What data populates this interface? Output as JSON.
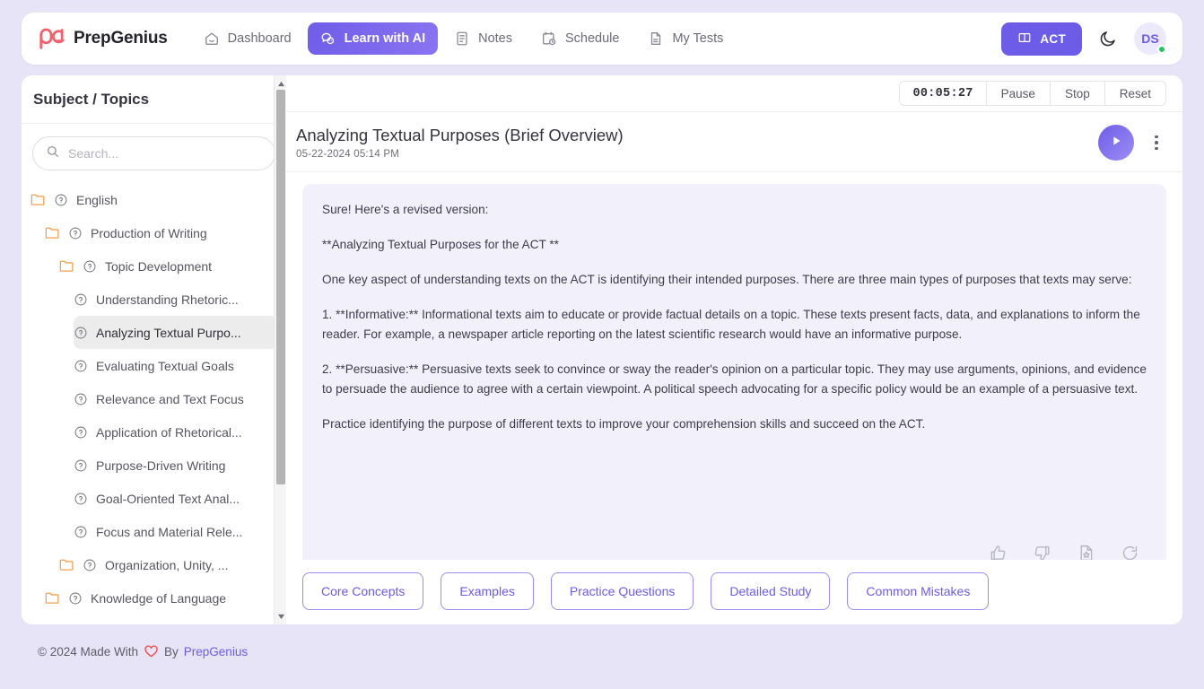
{
  "app": {
    "brand_name": "PrepGenius",
    "logo_icon": "pg-monogram-logo"
  },
  "header": {
    "nav": [
      {
        "label": "Dashboard",
        "icon": "home-icon",
        "active": false
      },
      {
        "label": "Learn with AI",
        "icon": "chat-bubbles-icon",
        "active": true
      },
      {
        "label": "Notes",
        "icon": "note-icon",
        "active": false
      },
      {
        "label": "Schedule",
        "icon": "calendar-clock-icon",
        "active": false
      },
      {
        "label": "My Tests",
        "icon": "file-text-icon",
        "active": false
      }
    ],
    "act_button": {
      "label": "ACT",
      "icon": "book-icon"
    },
    "theme_toggle_icon": "moon-icon",
    "avatar": {
      "initials": "DS",
      "status": "online"
    }
  },
  "sidebar": {
    "title": "Subject / Topics",
    "search": {
      "placeholder": "Search...",
      "value": "",
      "icon": "search-icon"
    },
    "tree": [
      {
        "label": "English",
        "depth": 0,
        "folder": true,
        "selected": false
      },
      {
        "label": "Production of Writing",
        "depth": 1,
        "folder": true,
        "selected": false
      },
      {
        "label": "Topic Development",
        "depth": 2,
        "folder": true,
        "selected": false
      },
      {
        "label": "Understanding Rhetoric...",
        "depth": 3,
        "folder": false,
        "selected": false
      },
      {
        "label": "Analyzing Textual Purpo...",
        "depth": 3,
        "folder": false,
        "selected": true
      },
      {
        "label": "Evaluating Textual Goals",
        "depth": 3,
        "folder": false,
        "selected": false
      },
      {
        "label": "Relevance and Text Focus",
        "depth": 3,
        "folder": false,
        "selected": false
      },
      {
        "label": "Application of Rhetorical...",
        "depth": 3,
        "folder": false,
        "selected": false
      },
      {
        "label": "Purpose-Driven Writing",
        "depth": 3,
        "folder": false,
        "selected": false
      },
      {
        "label": "Goal-Oriented Text Anal...",
        "depth": 3,
        "folder": false,
        "selected": false
      },
      {
        "label": "Focus and Material Rele...",
        "depth": 3,
        "folder": false,
        "selected": false
      },
      {
        "label": "Organization, Unity, ...",
        "depth": 2,
        "folder": true,
        "selected": false
      },
      {
        "label": "Knowledge of Language",
        "depth": 1,
        "folder": true,
        "selected": false
      }
    ],
    "scrollbar": {
      "up_icon": "scroll-up-arrow-icon",
      "down_icon": "scroll-down-arrow-icon"
    }
  },
  "main": {
    "timer": {
      "value": "00:05:27",
      "pause_label": "Pause",
      "stop_label": "Stop",
      "reset_label": "Reset"
    },
    "document": {
      "title": "Analyzing Textual Purposes (Brief Overview)",
      "date": "05-22-2024 05:14 PM",
      "play_icon": "play-icon",
      "menu_icon": "more-vertical-icon"
    },
    "content_paragraphs": [
      "Sure! Here's a revised version:",
      "**Analyzing Textual Purposes for the ACT **",
      "One key aspect of understanding texts on the ACT is identifying their intended purposes. There are three main types of purposes that texts may serve:",
      "1. **Informative:** Informational texts aim to educate or provide factual details on a topic. These texts present facts, data, and explanations to inform the reader. For example, a newspaper article reporting on the latest scientific research would have an informative purpose.",
      "2. **Persuasive:** Persuasive texts seek to convince or sway the reader's opinion on a particular topic. They may use arguments, opinions, and evidence to persuade the audience to agree with a certain viewpoint. A political speech advocating for a specific policy would be an example of a persuasive text.",
      "Practice identifying the purpose of different texts to improve your comprehension skills and succeed on the ACT."
    ],
    "feedback_icons": [
      "thumbs-up-icon",
      "thumbs-down-icon",
      "save-to-notes-icon",
      "regenerate-icon"
    ],
    "chips": [
      "Core Concepts",
      "Examples",
      "Practice Questions",
      "Detailed Study",
      "Common Mistakes"
    ]
  },
  "footer": {
    "copyright": "© 2024 Made With",
    "heart_icon": "heart-icon",
    "by": "By",
    "brand": "PrepGenius"
  },
  "colors": {
    "page_bg": "#e7e4f7",
    "accent": "#6c5ce7",
    "content_card_bg": "#f2f1fb",
    "folder": "#f59e4b",
    "heart": "#ef4444",
    "status_online": "#22c55e"
  }
}
